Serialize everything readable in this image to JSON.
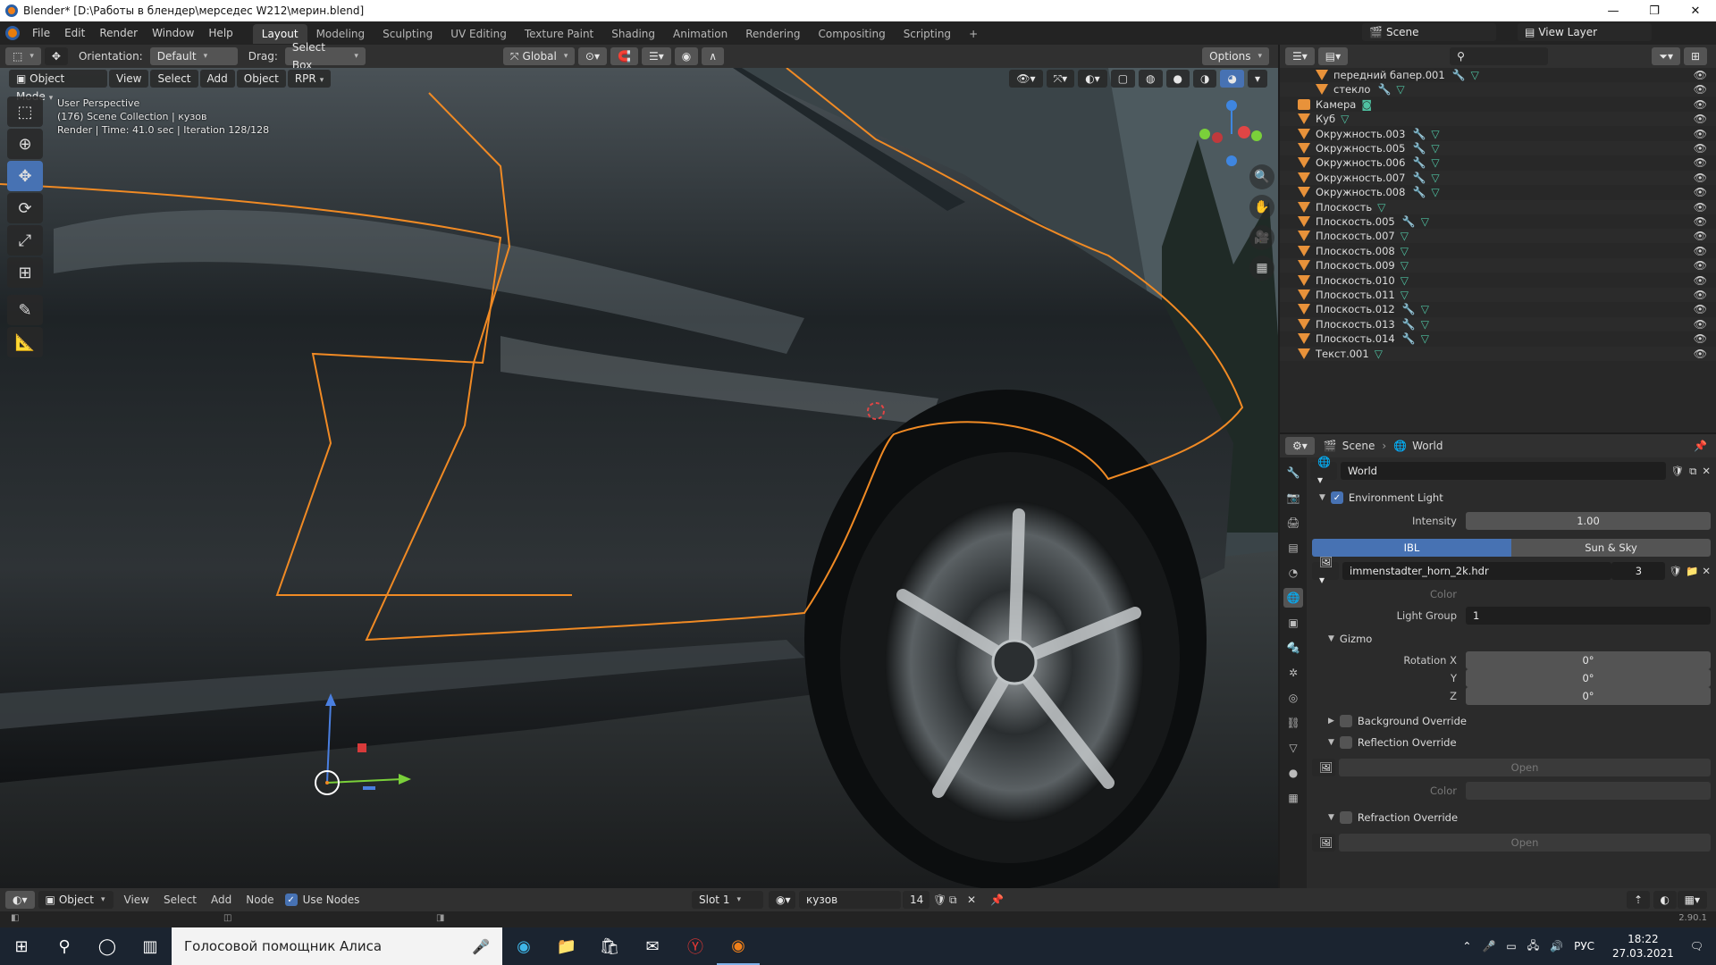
{
  "window": {
    "title": "Blender* [D:\\Работы в блендер\\мерседес W212\\мерин.blend]",
    "controls": {
      "minimize": "—",
      "maximize": "❐",
      "close": "✕"
    }
  },
  "menu": [
    "File",
    "Edit",
    "Render",
    "Window",
    "Help"
  ],
  "workspaces": [
    "Layout",
    "Modeling",
    "Sculpting",
    "UV Editing",
    "Texture Paint",
    "Shading",
    "Animation",
    "Rendering",
    "Compositing",
    "Scripting"
  ],
  "workspace_add": "+",
  "scene_selector": {
    "scene": "Scene",
    "view_layer": "View Layer"
  },
  "viewport_header": {
    "orientation_label": "Orientation:",
    "orientation_value": "Default",
    "drag_label": "Drag:",
    "drag_value": "Select Box",
    "transform_orientation": "Global",
    "options": "Options"
  },
  "viewport_subheader": {
    "mode": "Object Mode",
    "view": "View",
    "select": "Select",
    "add": "Add",
    "object": "Object",
    "render_engine": "RPR"
  },
  "viewport_info": {
    "line1": "User Perspective",
    "line2": "(176) Scene Collection | кузов",
    "line3": "Render | Time: 41.0 sec | Iteration 128/128"
  },
  "outliner": {
    "rows": [
      {
        "name": "передний бапер.001",
        "modifier": true,
        "mesh": true,
        "indent": 2
      },
      {
        "name": "стекло",
        "modifier": true,
        "mesh": true,
        "indent": 2
      },
      {
        "name": "Камера",
        "type": "camera",
        "modifier": false,
        "mesh": false,
        "indent": 1
      },
      {
        "name": "Куб",
        "modifier": false,
        "mesh": true,
        "indent": 1
      },
      {
        "name": "Окружность.003",
        "modifier": true,
        "mesh": true,
        "indent": 1
      },
      {
        "name": "Окружность.005",
        "modifier": true,
        "mesh": true,
        "indent": 1
      },
      {
        "name": "Окружность.006",
        "modifier": true,
        "mesh": true,
        "indent": 1
      },
      {
        "name": "Окружность.007",
        "modifier": true,
        "mesh": true,
        "indent": 1
      },
      {
        "name": "Окружность.008",
        "modifier": true,
        "mesh": true,
        "indent": 1
      },
      {
        "name": "Плоскость",
        "modifier": false,
        "mesh": true,
        "indent": 1
      },
      {
        "name": "Плоскость.005",
        "modifier": true,
        "mesh": true,
        "indent": 1
      },
      {
        "name": "Плоскость.007",
        "modifier": false,
        "mesh": true,
        "indent": 1
      },
      {
        "name": "Плоскость.008",
        "modifier": false,
        "mesh": true,
        "indent": 1
      },
      {
        "name": "Плоскость.009",
        "modifier": false,
        "mesh": true,
        "indent": 1
      },
      {
        "name": "Плоскость.010",
        "modifier": false,
        "mesh": true,
        "indent": 1
      },
      {
        "name": "Плоскость.011",
        "modifier": false,
        "mesh": true,
        "indent": 1
      },
      {
        "name": "Плоскость.012",
        "modifier": true,
        "mesh": true,
        "indent": 1
      },
      {
        "name": "Плоскость.013",
        "modifier": true,
        "mesh": true,
        "indent": 1
      },
      {
        "name": "Плоскость.014",
        "modifier": true,
        "mesh": true,
        "indent": 1
      },
      {
        "name": "Текст.001",
        "modifier": false,
        "mesh": true,
        "indent": 1
      }
    ]
  },
  "properties": {
    "breadcrumb": {
      "scene": "Scene",
      "separator": "›",
      "world": "World"
    },
    "world_name": "World",
    "environment_light": {
      "label": "Environment Light",
      "enabled": true
    },
    "intensity": {
      "label": "Intensity",
      "value": "1.00"
    },
    "light_type": {
      "ibl": "IBL",
      "sun_sky": "Sun & Sky",
      "active": "IBL"
    },
    "image": {
      "name": "immenstadter_horn_2k.hdr",
      "users": "3"
    },
    "color_label": "Color",
    "light_group": {
      "label": "Light Group",
      "value": "1"
    },
    "gizmo": {
      "label": "Gizmo",
      "rotation_x": {
        "label": "Rotation X",
        "value": "0°"
      },
      "rotation_y": {
        "label": "Y",
        "value": "0°"
      },
      "rotation_z": {
        "label": "Z",
        "value": "0°"
      }
    },
    "background_override": "Background Override",
    "reflection_override": "Reflection Override",
    "reflection_open": "Open",
    "reflection_color_label": "Color",
    "refraction_override": "Refraction Override",
    "refraction_open": "Open"
  },
  "bottom_header": {
    "editor_mode": "Object",
    "view": "View",
    "select": "Select",
    "add": "Add",
    "node": "Node",
    "use_nodes": "Use Nodes",
    "use_nodes_checked": true,
    "slot": "Slot 1",
    "material": "кузов",
    "users": "14"
  },
  "timeline": {
    "version": "2.90.1"
  },
  "taskbar": {
    "search_text": "Голосовой помощник Алиса",
    "language": "РУС",
    "time": "18:22",
    "date": "27.03.2021"
  },
  "colors": {
    "accent": "#4772b3",
    "selection_outline": "#f08a24",
    "mesh_icon": "#4fc1a1",
    "object_icon": "#e8923a"
  }
}
